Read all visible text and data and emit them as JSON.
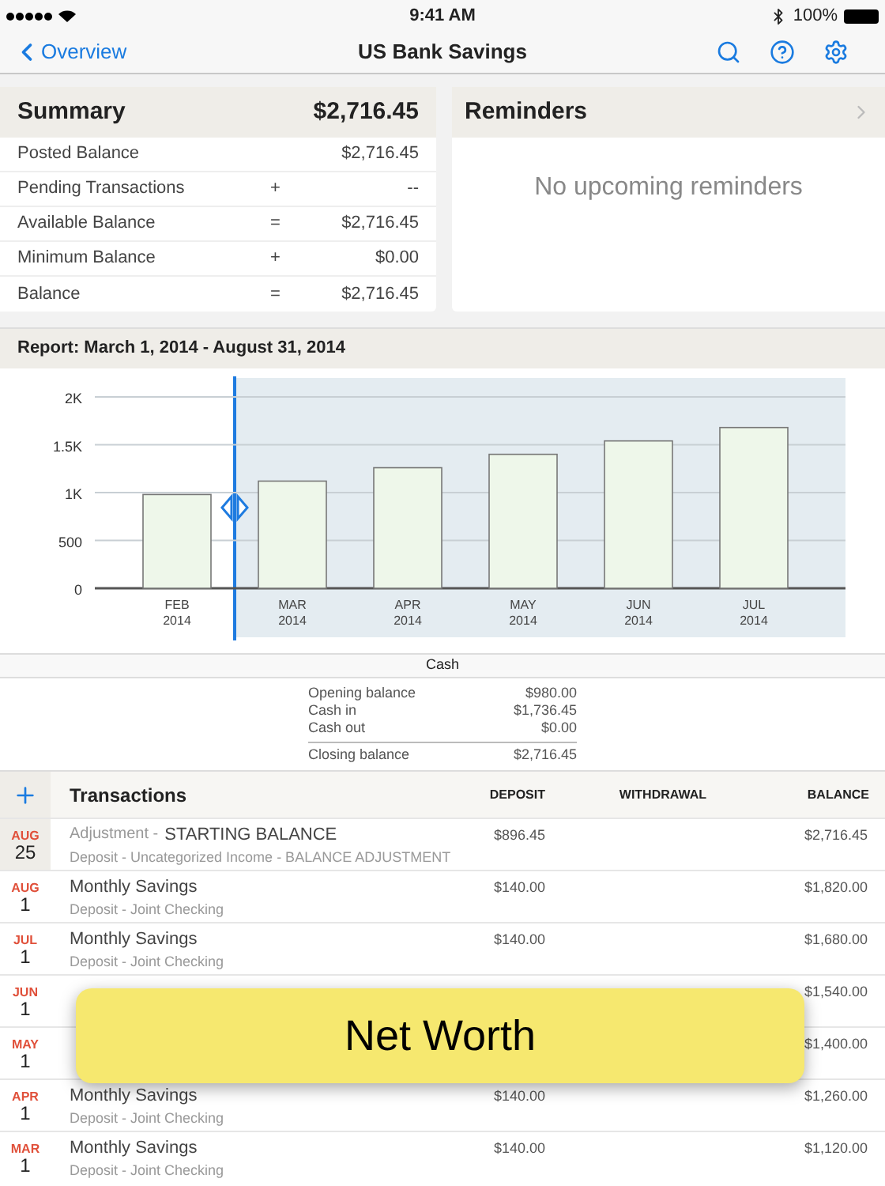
{
  "status_bar": {
    "time": "9:41 AM",
    "battery": "100%"
  },
  "nav": {
    "back": "Overview",
    "title": "US Bank Savings"
  },
  "summary": {
    "title": "Summary",
    "total": "$2,716.45",
    "rows": [
      {
        "label": "Posted Balance",
        "op": "",
        "value": "$2,716.45"
      },
      {
        "label": "Pending Transactions",
        "op": "+",
        "value": "--"
      },
      {
        "label": "Available Balance",
        "op": "=",
        "value": "$2,716.45"
      },
      {
        "label": "Minimum Balance",
        "op": "+",
        "value": "$0.00"
      },
      {
        "label": "Balance",
        "op": "=",
        "value": "$2,716.45"
      }
    ]
  },
  "reminders": {
    "title": "Reminders",
    "empty": "No upcoming reminders"
  },
  "report": {
    "title": "Report: March 1, 2014 - August 31, 2014",
    "chart_data": {
      "type": "bar",
      "categories": [
        "FEB 2014",
        "MAR 2014",
        "APR 2014",
        "MAY 2014",
        "JUN 2014",
        "JUL 2014"
      ],
      "series": [
        {
          "color": "#eef7ea",
          "values": [
            980,
            1120,
            1260,
            1400,
            1540,
            1680
          ]
        }
      ],
      "grid": true,
      "ylim": [
        0,
        2000
      ],
      "yticks": [
        {
          "value": 0,
          "label": "0"
        },
        {
          "value": 500,
          "label": "500"
        },
        {
          "value": 1000,
          "label": "1K"
        },
        {
          "value": 1500,
          "label": "1.5K"
        },
        {
          "value": 2000,
          "label": "2K"
        }
      ]
    }
  },
  "cash": {
    "title": "Cash",
    "rows": [
      {
        "label": "Opening balance",
        "value": "$980.00"
      },
      {
        "label": "Cash in",
        "value": "$1,736.45"
      },
      {
        "label": "Cash out",
        "value": "$0.00"
      }
    ],
    "total": {
      "label": "Closing balance",
      "value": "$2,716.45"
    }
  },
  "transactions": {
    "columns": [
      "Transactions",
      "DEPOSIT",
      "WITHDRAWAL",
      "BALANCE"
    ],
    "rows": [
      {
        "month": "AUG",
        "day": "25",
        "selected": true,
        "prefix": "Adjustment -",
        "title": "STARTING BALANCE",
        "detail": "Deposit - Uncategorized Income - BALANCE ADJUSTMENT",
        "deposit": "$896.45",
        "balance": "$2,716.45"
      },
      {
        "month": "AUG",
        "day": "1",
        "selected": false,
        "title": "Monthly Savings",
        "detail": "Deposit - Joint Checking",
        "deposit": "$140.00",
        "balance": "$1,820.00"
      },
      {
        "month": "JUL",
        "day": "1",
        "selected": false,
        "title": "Monthly Savings",
        "detail": "Deposit - Joint Checking",
        "deposit": "$140.00",
        "balance": "$1,680.00"
      },
      {
        "month": "JUN",
        "day": "1",
        "selected": false,
        "balance": "$1,540.00"
      },
      {
        "month": "MAY",
        "day": "1",
        "selected": false,
        "balance": "$1,400.00"
      },
      {
        "month": "APR",
        "day": "1",
        "selected": false,
        "title": "Monthly Savings",
        "detail": "Deposit - Joint Checking",
        "deposit": "$140.00",
        "balance": "$1,260.00"
      },
      {
        "month": "MAR",
        "day": "1",
        "selected": false,
        "title": "Monthly Savings",
        "detail": "Deposit - Joint Checking",
        "deposit": "$140.00",
        "balance": "$1,120.00"
      }
    ]
  },
  "banner": {
    "text": "Net Worth"
  }
}
